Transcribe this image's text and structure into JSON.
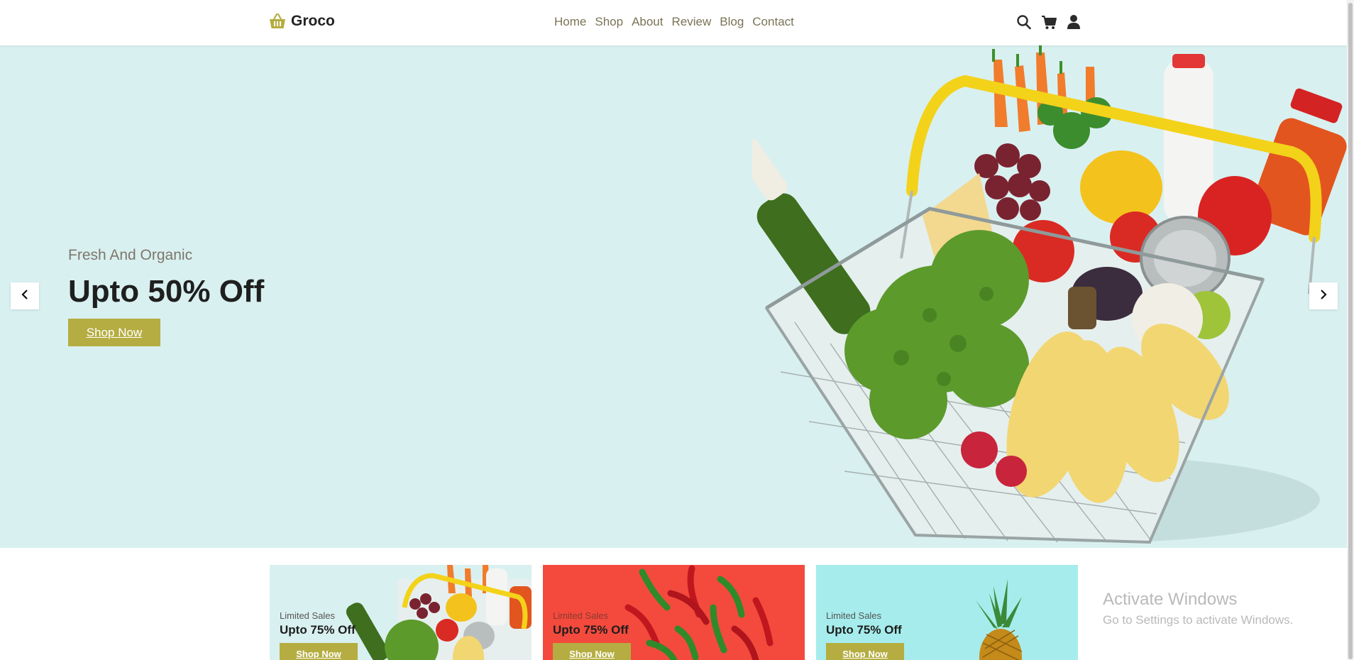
{
  "brand": {
    "name": "Groco",
    "icon": "basket-icon",
    "color": "#b5ad41"
  },
  "nav": {
    "items": [
      "Home",
      "Shop",
      "About",
      "Review",
      "Blog",
      "Contact"
    ]
  },
  "header_icons": [
    "search-icon",
    "cart-icon",
    "user-icon"
  ],
  "hero": {
    "subtitle": "Fresh And Organic",
    "title": "Upto 50% Off",
    "button": "Shop Now",
    "background": "#d9f0f0",
    "image": "grocery-basket-photo"
  },
  "carousel": {
    "prev_icon": "chevron-left-icon",
    "next_icon": "chevron-right-icon"
  },
  "banners": [
    {
      "tag": "Limited Sales",
      "title": "Upto 75% Off",
      "button": "Shop Now",
      "background": "#d9f0f0",
      "image": "grocery-basket-photo"
    },
    {
      "tag": "Limited Sales",
      "title": "Upto 75% Off",
      "button": "Shop Now",
      "background": "#f34a3d",
      "image": "chili-peppers-photo"
    },
    {
      "tag": "Limited Sales",
      "title": "Upto 75% Off",
      "button": "Shop Now",
      "background": "#a6ecec",
      "image": "pineapple-photo"
    }
  ],
  "watermark": {
    "title": "Activate Windows",
    "subtitle": "Go to Settings to activate Windows."
  },
  "colors": {
    "accent": "#b5ad41",
    "nav_text": "#7a7356",
    "heading": "#1f1f1f"
  }
}
